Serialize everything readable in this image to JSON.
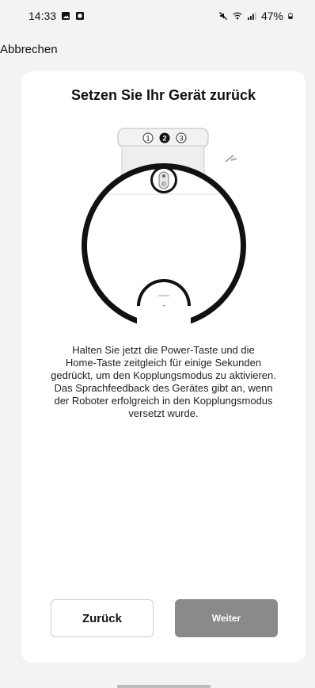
{
  "status_bar": {
    "time": "14:33",
    "battery": "47%",
    "icons": [
      "image-icon",
      "notification-icon",
      "mute-icon",
      "wifi-icon",
      "signal-icon",
      "battery-icon"
    ]
  },
  "top_bar": {
    "cancel_label": "Abbrechen"
  },
  "card": {
    "title": "Setzen Sie Ihr Gerät zurück",
    "illustration": {
      "step_labels": [
        "1",
        "2",
        "3"
      ],
      "active_step": 2
    },
    "description": "Halten Sie jetzt die Power-Taste und die\nHome-Taste zeitgleich für einige Sekunden\ngedrückt, um den Kopplungsmodus zu aktivieren.\nDas Sprachfeedback des Gerätes gibt an, wenn\nder Roboter erfolgreich in den Kopplungsmodus\nversetzt wurde.",
    "back_label": "Zurück",
    "next_label": "Weiter"
  }
}
